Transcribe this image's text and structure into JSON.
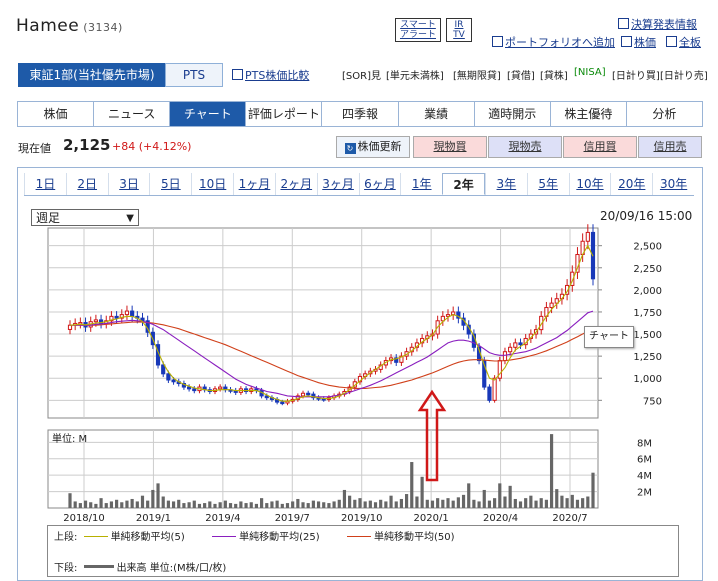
{
  "header": {
    "company": "Hamee",
    "code": "(3134)",
    "smart_alert": [
      "スマート",
      "アラート"
    ],
    "ir_tv": [
      "IR",
      "TV"
    ],
    "links": [
      "決算発表情報",
      "ポートフォリオへ追加",
      "株価",
      "全板"
    ]
  },
  "market_tabs": [
    "東証1部(当社優先市場)",
    "PTS"
  ],
  "pts_compare": "PTS株価比較",
  "tags": [
    "[SOR]見",
    "[単元未満株]",
    "[無期限貸]",
    "[貸借]",
    "[貸株]",
    "[NISA]",
    "[日計り買]",
    "[日計り売]"
  ],
  "nav": [
    "株価",
    "ニュース",
    "チャート",
    "評価レポート",
    "四季報",
    "業績",
    "適時開示",
    "株主優待",
    "分析"
  ],
  "price": {
    "label": "現在値",
    "value": "2,125",
    "change": "+84 (+4.12%)"
  },
  "actions": [
    "株価更新",
    "現物買",
    "現物売",
    "信用買",
    "信用売"
  ],
  "periods": [
    "1日",
    "2日",
    "3日",
    "5日",
    "10日",
    "1ヶ月",
    "2ヶ月",
    "3ヶ月",
    "6ヶ月",
    "1年",
    "2年",
    "3年",
    "5年",
    "10年",
    "20年",
    "30年"
  ],
  "active_period": "2年",
  "select_value": "週足",
  "timestamp": "20/09/16 15:00",
  "tooltip": "チャート",
  "volume_unit": "単位: M",
  "legend": {
    "upper": "上段:",
    "ma5": "単純移動平均(5)",
    "ma25": "単純移動平均(25)",
    "ma50": "単純移動平均(50)",
    "lower": "下段:",
    "volume": "出来高 単位:(M株/口/枚)"
  },
  "colors": {
    "brand": "#1e5aa8",
    "up": "#d01818",
    "down": "#1838b8",
    "ma5": "#b8b000",
    "ma25": "#8a1fbf",
    "ma50": "#d0401a",
    "arrow": "#d01818"
  },
  "chart_data": {
    "type": "candlestick",
    "x_ticks": [
      "2018/10",
      "2019/1",
      "2019/4",
      "2019/7",
      "2019/10",
      "2020/1",
      "2020/4",
      "2020/7"
    ],
    "price_ticks": [
      750,
      1000,
      1250,
      1500,
      1750,
      2000,
      2250,
      2500
    ],
    "volume_ticks": [
      "2M",
      "4M",
      "6M",
      "8M"
    ],
    "price_ylim": [
      550,
      2700
    ],
    "volume_ylim": [
      0,
      9.5
    ],
    "close": [
      1600,
      1620,
      1630,
      1580,
      1640,
      1660,
      1620,
      1650,
      1700,
      1680,
      1720,
      1760,
      1700,
      1680,
      1650,
      1520,
      1380,
      1150,
      1050,
      980,
      960,
      940,
      900,
      880,
      860,
      900,
      870,
      850,
      880,
      900,
      870,
      860,
      840,
      880,
      850,
      880,
      860,
      800,
      780,
      760,
      730,
      720,
      740,
      760,
      800,
      830,
      820,
      780,
      770,
      760,
      780,
      800,
      820,
      850,
      900,
      960,
      1020,
      1050,
      1080,
      1100,
      1150,
      1200,
      1230,
      1180,
      1250,
      1300,
      1350,
      1400,
      1450,
      1480,
      1500,
      1650,
      1700,
      1720,
      1750,
      1680,
      1600,
      1500,
      1350,
      1200,
      900,
      750,
      1000,
      1200,
      1300,
      1350,
      1400,
      1380,
      1450,
      1500,
      1550,
      1700,
      1800,
      1850,
      1900,
      1950,
      2050,
      2200,
      2400,
      2550,
      2650,
      2125
    ],
    "ma5": [
      1600,
      1605,
      1610,
      1605,
      1615,
      1625,
      1630,
      1640,
      1660,
      1670,
      1690,
      1700,
      1700,
      1680,
      1640,
      1560,
      1440,
      1300,
      1170,
      1070,
      1000,
      960,
      930,
      910,
      890,
      880,
      870,
      860,
      860,
      870,
      870,
      870,
      860,
      860,
      860,
      860,
      860,
      840,
      810,
      780,
      760,
      740,
      740,
      750,
      770,
      790,
      800,
      790,
      780,
      770,
      770,
      780,
      800,
      830,
      870,
      920,
      970,
      1020,
      1060,
      1100,
      1140,
      1180,
      1210,
      1220,
      1240,
      1270,
      1310,
      1360,
      1410,
      1450,
      1490,
      1580,
      1640,
      1690,
      1720,
      1700,
      1660,
      1580,
      1480,
      1320,
      1150,
      1000,
      980,
      1050,
      1120,
      1230,
      1320,
      1360,
      1400,
      1460,
      1520,
      1610,
      1700,
      1780,
      1840,
      1900,
      1980,
      2100,
      2250,
      2400,
      2500,
      2380
    ],
    "ma25": [
      1600,
      1600,
      1600,
      1600,
      1600,
      1610,
      1615,
      1620,
      1630,
      1640,
      1645,
      1650,
      1655,
      1650,
      1645,
      1630,
      1610,
      1580,
      1550,
      1510,
      1470,
      1430,
      1390,
      1350,
      1310,
      1270,
      1230,
      1190,
      1150,
      1110,
      1070,
      1030,
      990,
      960,
      930,
      910,
      890,
      870,
      850,
      840,
      830,
      815,
      800,
      795,
      790,
      790,
      790,
      790,
      790,
      790,
      790,
      800,
      810,
      820,
      840,
      860,
      880,
      900,
      920,
      945,
      970,
      1000,
      1030,
      1060,
      1090,
      1120,
      1150,
      1180,
      1210,
      1240,
      1280,
      1320,
      1360,
      1400,
      1420,
      1430,
      1430,
      1420,
      1400,
      1370,
      1330,
      1290,
      1270,
      1260,
      1260,
      1270,
      1280,
      1290,
      1300,
      1320,
      1340,
      1370,
      1400,
      1430,
      1460,
      1500,
      1540,
      1590,
      1640,
      1690,
      1740,
      1760
    ],
    "ma50": [
      1600,
      1600,
      1600,
      1600,
      1600,
      1600,
      1605,
      1610,
      1615,
      1620,
      1625,
      1630,
      1635,
      1635,
      1635,
      1630,
      1625,
      1615,
      1605,
      1590,
      1575,
      1560,
      1540,
      1520,
      1500,
      1480,
      1460,
      1440,
      1420,
      1400,
      1380,
      1355,
      1330,
      1305,
      1280,
      1255,
      1230,
      1205,
      1180,
      1155,
      1130,
      1105,
      1080,
      1055,
      1030,
      1010,
      990,
      970,
      950,
      935,
      920,
      910,
      900,
      895,
      890,
      885,
      885,
      885,
      890,
      895,
      900,
      910,
      920,
      935,
      950,
      965,
      980,
      1000,
      1020,
      1040,
      1060,
      1085,
      1110,
      1135,
      1160,
      1180,
      1195,
      1205,
      1210,
      1210,
      1205,
      1200,
      1195,
      1195,
      1200,
      1205,
      1215,
      1225,
      1240,
      1255,
      1270,
      1290,
      1310,
      1335,
      1360,
      1385,
      1410,
      1440,
      1470,
      1500,
      1530,
      1550
    ],
    "volume": [
      1.8,
      0.8,
      0.6,
      0.9,
      0.7,
      0.5,
      1.2,
      0.6,
      0.8,
      1.0,
      0.7,
      0.9,
      1.1,
      0.8,
      1.5,
      0.9,
      2.2,
      3.0,
      1.4,
      0.9,
      0.8,
      1.0,
      0.6,
      0.7,
      0.9,
      0.5,
      0.6,
      0.8,
      0.5,
      0.7,
      0.9,
      0.6,
      0.5,
      0.8,
      0.6,
      0.7,
      0.5,
      1.2,
      0.6,
      0.8,
      0.9,
      0.5,
      0.6,
      0.8,
      1.1,
      0.7,
      0.6,
      0.9,
      0.8,
      0.7,
      0.6,
      0.8,
      1.0,
      2.2,
      1.5,
      1.0,
      1.2,
      0.8,
      0.9,
      0.7,
      1.0,
      0.8,
      1.5,
      0.8,
      1.1,
      1.7,
      5.6,
      1.4,
      3.8,
      1.0,
      0.9,
      1.2,
      1.0,
      1.2,
      0.9,
      1.3,
      1.6,
      3.0,
      1.0,
      0.8,
      2.2,
      0.9,
      1.2,
      3.0,
      1.4,
      2.7,
      1.1,
      0.8,
      1.2,
      1.5,
      0.9,
      1.2,
      1.0,
      9.0,
      2.3,
      1.5,
      1.2,
      1.6,
      1.0,
      1.2,
      1.4,
      4.3
    ]
  }
}
